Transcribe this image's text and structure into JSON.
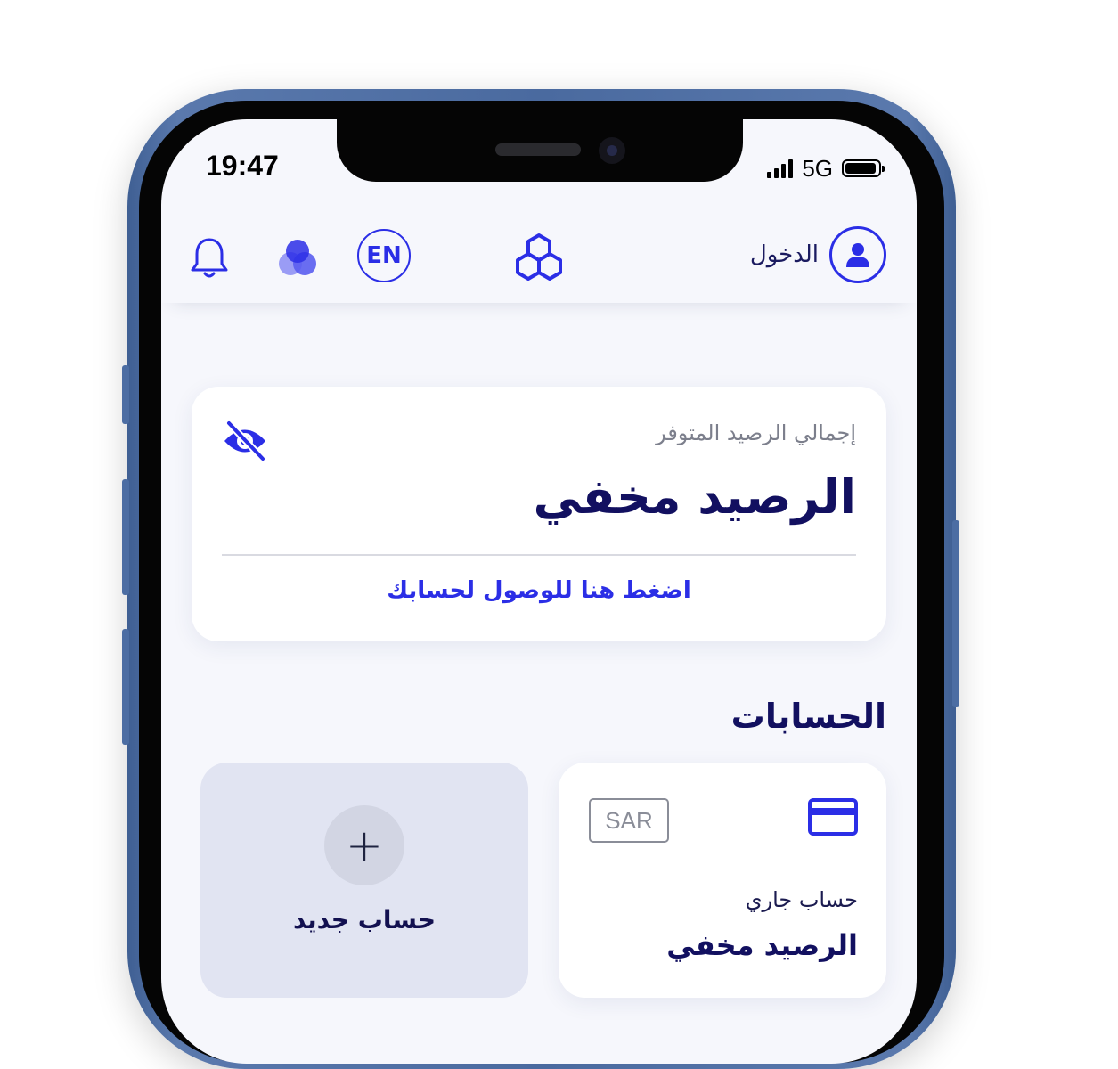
{
  "status_bar": {
    "time": "19:47",
    "network": "5G",
    "signal_icon": "signal-bars-icon",
    "battery_icon": "battery-icon"
  },
  "header": {
    "notifications_icon": "bell-icon",
    "switch_icon": "overlapping-circles-icon",
    "language_label": "EN",
    "logo_icon": "logo-hexagon-icon",
    "login_label": "الدخول",
    "avatar_icon": "user-avatar-icon"
  },
  "balance_card": {
    "total_label": "إجمالي الرصيد المتوفر",
    "balance_value": "الرصيد مخفي",
    "toggle_icon": "eye-slash-icon",
    "access_link": "اضغط هنا للوصول لحسابك"
  },
  "accounts": {
    "title": "الحسابات",
    "items": [
      {
        "currency": "SAR",
        "icon": "credit-card-icon",
        "type": "حساب جاري",
        "balance": "الرصيد مخفي"
      }
    ],
    "new_account": {
      "plus": "+",
      "label": "حساب جديد"
    }
  },
  "colors": {
    "accent": "#2b2ee6",
    "dark_text": "#121060",
    "muted_text": "#7c7f8c",
    "screen_bg": "#f6f7fc",
    "card_bg": "#ffffff",
    "new_card_bg": "#e1e4f2",
    "frame": "#4a6a9f"
  }
}
